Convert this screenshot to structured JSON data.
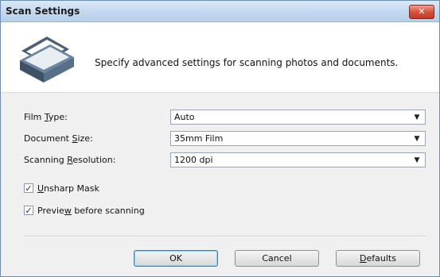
{
  "window": {
    "title": "Scan Settings",
    "close_label": "✕"
  },
  "header": {
    "description": "Specify advanced settings for scanning photos and documents."
  },
  "settings": {
    "film_type": {
      "label_pre": "Film ",
      "label_key": "T",
      "label_post": "ype:",
      "value": "Auto"
    },
    "document_size": {
      "label_pre": "Document ",
      "label_key": "S",
      "label_post": "ize:",
      "value": "35mm Film"
    },
    "resolution": {
      "label_pre": "Scanning ",
      "label_key": "R",
      "label_post": "esolution:",
      "value": "1200 dpi"
    }
  },
  "options": {
    "unsharp_mask": {
      "label_key": "U",
      "label_post": "nsharp Mask",
      "checked": true
    },
    "preview": {
      "label_pre": "Previe",
      "label_key": "w",
      "label_post": " before scanning",
      "checked": true
    }
  },
  "buttons": {
    "ok": "OK",
    "cancel": "Cancel",
    "defaults_key": "D",
    "defaults_post": "efaults"
  },
  "icons": {
    "dropdown": "chevron-down-icon",
    "check": "checkmark-icon",
    "scanner": "scanner-icon"
  },
  "colors": {
    "title_bar": "#c4d8ee",
    "close": "#d9533b",
    "scanner_body": "#4a6075"
  }
}
